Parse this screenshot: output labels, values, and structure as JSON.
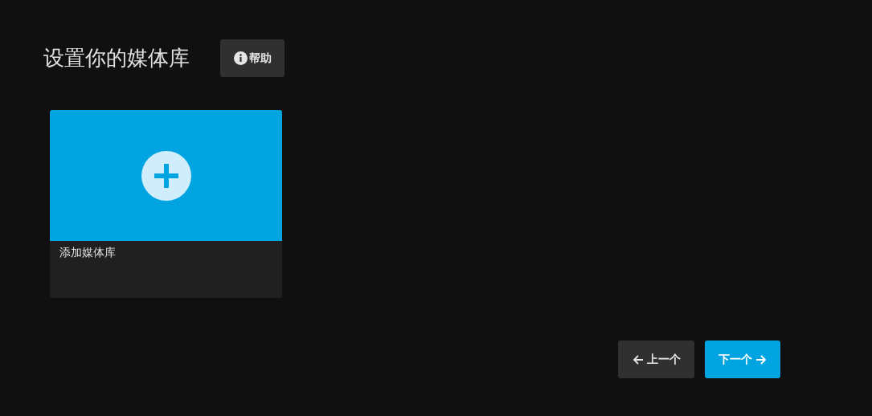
{
  "header": {
    "title": "设置你的媒体库",
    "help_button": "帮助"
  },
  "libraries": [
    {
      "kind": "add",
      "label": "添加媒体库"
    }
  ],
  "nav_buttons": [
    {
      "kind": "back",
      "label": "上一个"
    },
    {
      "kind": "next",
      "label": "下一个"
    }
  ]
}
